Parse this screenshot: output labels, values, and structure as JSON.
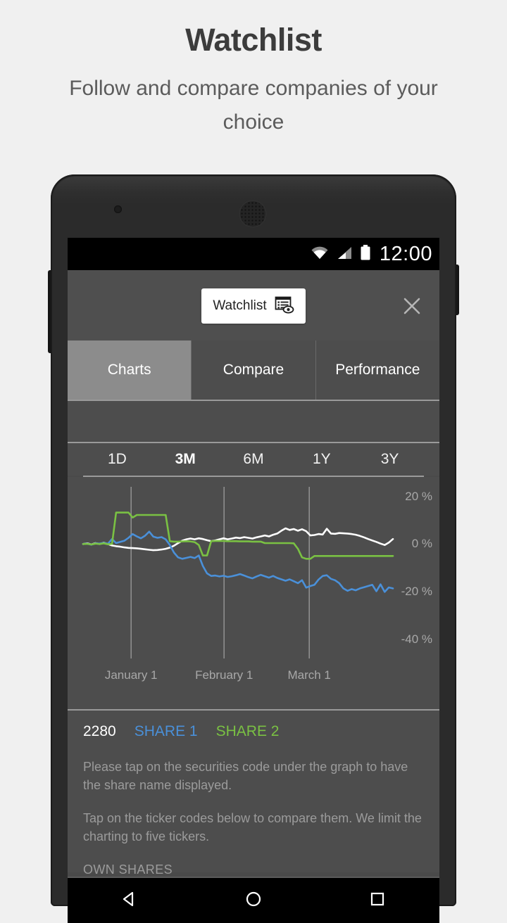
{
  "promo": {
    "title": "Watchlist",
    "subtitle": "Follow and compare companies of your choice"
  },
  "statusbar": {
    "time": "12:00",
    "wifi_icon": "wifi-icon",
    "signal_icon": "cellular-signal-icon",
    "battery_icon": "battery-full-icon"
  },
  "appbar": {
    "badge_label": "Watchlist",
    "badge_icon": "watchlist-document-eye-icon",
    "close_label": "×"
  },
  "tabs": [
    {
      "label": "Charts",
      "active": true
    },
    {
      "label": "Compare",
      "active": false
    },
    {
      "label": "Performance",
      "active": false
    }
  ],
  "ranges": [
    {
      "label": "1D",
      "active": false
    },
    {
      "label": "3M",
      "active": true
    },
    {
      "label": "6M",
      "active": false
    },
    {
      "label": "1Y",
      "active": false
    },
    {
      "label": "3Y",
      "active": false
    }
  ],
  "tickers": {
    "own_code": "2280",
    "share1": "SHARE 1",
    "share2": "SHARE 2",
    "share1_color": "#4a90d9",
    "share2_color": "#7ac143",
    "own_color": "#ffffff"
  },
  "hints": {
    "line1": "Please tap on the securities code under the graph to have the share name displayed.",
    "line2": "Tap on the ticker codes below to compare them. We limit the charting to five tickers.",
    "section_label": "OWN SHARES"
  },
  "navbar": {
    "back": "back-triangle-icon",
    "home": "home-circle-icon",
    "recents": "recents-square-icon"
  },
  "chart_data": {
    "type": "line",
    "title": "",
    "xlabel": "",
    "ylabel": "%",
    "ylim": [
      -48,
      24
    ],
    "yticks": [
      20,
      0,
      -20,
      -40
    ],
    "ytick_labels": [
      "20 %",
      "0 %",
      "-20 %",
      "-40 %"
    ],
    "grid": "vertical-only",
    "xtick_labels": [
      "January 1",
      "February 1",
      "March 1"
    ],
    "xtick_positions": [
      0.155,
      0.455,
      0.73
    ],
    "legend": "below-chart",
    "series": [
      {
        "name": "2280",
        "color": "#ffffff",
        "values": [
          0,
          0.3,
          -0.2,
          0.4,
          0,
          0.6,
          0,
          -0.6,
          -0.9,
          -1.1,
          -1.4,
          -1.6,
          -1.7,
          -1.8,
          -2.0,
          -2.2,
          -2.4,
          -2.6,
          -2.5,
          -2.3,
          -2.0,
          -1.5,
          -0.7,
          0.4,
          1.4,
          2.0,
          2.3,
          2.0,
          2.4,
          2.1,
          1.6,
          1.2,
          1.5,
          2.0,
          2.4,
          2.0,
          2.3,
          2.7,
          2.5,
          2.9,
          2.6,
          2.3,
          2.8,
          3.2,
          3.6,
          3.2,
          3.9,
          4.4,
          5.6,
          6.6,
          5.9,
          6.3,
          5.6,
          6.2,
          5.4,
          3.6,
          3.8,
          4.2,
          4.0,
          6.4,
          4.4,
          4.3,
          4.6,
          4.5,
          4.4,
          4.2,
          3.9,
          3.4,
          2.8,
          2.1,
          1.5,
          0.9,
          0.2,
          -0.4,
          0.6,
          2.1
        ]
      },
      {
        "name": "SHARE 1",
        "color": "#4a90d9",
        "values": [
          0,
          0.2,
          -0.3,
          0.3,
          0.2,
          0.5,
          0.1,
          2.1,
          0.4,
          0.9,
          1.4,
          2.6,
          4.2,
          3.2,
          2.4,
          3.5,
          5.2,
          3.1,
          2.6,
          2.9,
          2.0,
          -0.4,
          -3.6,
          -5.6,
          -6.2,
          -5.8,
          -5.4,
          -5.9,
          -4.8,
          -9.2,
          -12.3,
          -13.4,
          -13.2,
          -13.6,
          -13.3,
          -13.8,
          -13.5,
          -13.1,
          -12.6,
          -13.2,
          -13.9,
          -14.4,
          -13.6,
          -12.9,
          -13.5,
          -14.1,
          -13.4,
          -14.2,
          -14.8,
          -15.4,
          -14.8,
          -15.6,
          -16.4,
          -15.2,
          -18.3,
          -17.6,
          -17.1,
          -14.9,
          -13.4,
          -13.1,
          -14.6,
          -15.2,
          -16.4,
          -18.6,
          -19.6,
          -18.9,
          -19.4,
          -18.6,
          -18.1,
          -17.6,
          -17.1,
          -19.8,
          -16.9,
          -20.1,
          -18.2,
          -18.6
        ]
      },
      {
        "name": "SHARE 2",
        "color": "#7ac143",
        "values": [
          0,
          0.1,
          -0.2,
          0.2,
          0,
          0.3,
          -0.1,
          0.1,
          13.2,
          13.2,
          13.2,
          13.2,
          11.1,
          12.2,
          12.2,
          12.2,
          12.2,
          12.2,
          12.2,
          12.2,
          12.2,
          1.2,
          1.0,
          1.0,
          1.1,
          1.2,
          1.1,
          0.8,
          -0.4,
          -4.8,
          -4.8,
          1.2,
          1.3,
          1.3,
          1.3,
          1.2,
          1.2,
          1.2,
          1.1,
          1.1,
          1.1,
          1.0,
          1.0,
          1.0,
          0.4,
          0.4,
          0.4,
          0.4,
          0.4,
          0.4,
          0.4,
          0.3,
          -2.0,
          -5.6,
          -6.2,
          -6.2,
          -5.0,
          -5.0,
          -5.0,
          -5.0,
          -5.0,
          -5.0,
          -5.0,
          -5.0,
          -5.0,
          -5.0,
          -5.0,
          -5.0,
          -5.0,
          -5.0,
          -5.0,
          -5.0,
          -5.0,
          -5.0,
          -5.0,
          -5.0
        ]
      }
    ]
  }
}
